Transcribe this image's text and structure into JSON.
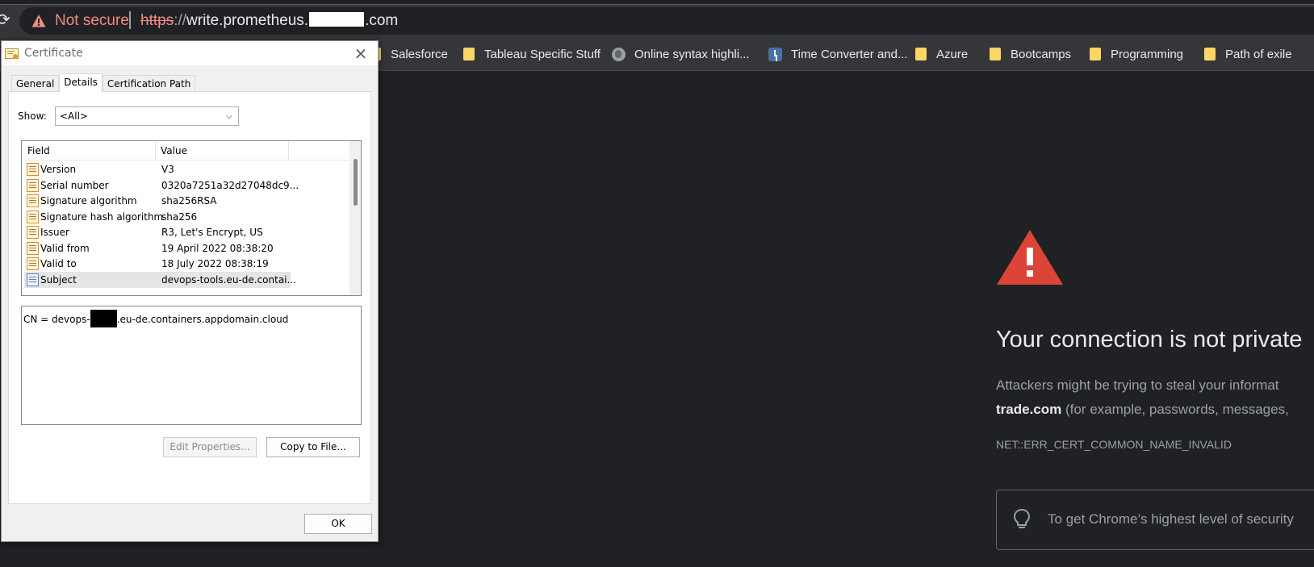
{
  "browser": {
    "security_label": "Not secure",
    "url_scheme_strike": "https",
    "url_scheme_rest": "://",
    "url_host_start": "write.prometheus.",
    "url_host_end": ".com",
    "bookmarks": [
      {
        "label": "Salesforce",
        "icon": "folder-icon"
      },
      {
        "label": "Tableau Specific Stuff",
        "icon": "folder-icon"
      },
      {
        "label": "Online syntax highli...",
        "icon": "globe-icon"
      },
      {
        "label": "Time Converter and...",
        "icon": "clock-icon"
      },
      {
        "label": "Azure",
        "icon": "folder-icon"
      },
      {
        "label": "Bootcamps",
        "icon": "folder-icon"
      },
      {
        "label": "Programming",
        "icon": "folder-icon"
      },
      {
        "label": "Path of exile",
        "icon": "folder-icon"
      }
    ]
  },
  "interstitial": {
    "title": "Your connection is not private",
    "line1": "Attackers might be trying to steal your informat",
    "line2_bold": "trade.com",
    "line2_rest": " (for example, passwords, messages,",
    "error_code": "NET::ERR_CERT_COMMON_NAME_INVALID",
    "tip": "To get Chrome’s highest level of security"
  },
  "dialog": {
    "title": "Certificate",
    "close": "×",
    "tabs": [
      "General",
      "Details",
      "Certification Path"
    ],
    "show_label": "Show:",
    "show_value": "<All>",
    "columns": {
      "field": "Field",
      "value": "Value"
    },
    "rows": [
      {
        "field": "Version",
        "value": "V3"
      },
      {
        "field": "Serial number",
        "value": "0320a7251a32d27048dc9..."
      },
      {
        "field": "Signature algorithm",
        "value": "sha256RSA"
      },
      {
        "field": "Signature hash algorithm",
        "value": "sha256"
      },
      {
        "field": "Issuer",
        "value": "R3, Let's Encrypt, US"
      },
      {
        "field": "Valid from",
        "value": "19 April 2022 08:38:20"
      },
      {
        "field": "Valid to",
        "value": "18 July 2022 08:38:19"
      },
      {
        "field": "Subject",
        "value": "devops-tools.eu-de.contai..."
      }
    ],
    "detail_prefix": "CN = devops-",
    "detail_suffix": ".eu-de.containers.appdomain.cloud",
    "edit_button": "Edit Properties...",
    "copy_button": "Copy to File...",
    "ok_button": "OK"
  },
  "colors": {
    "page_bg": "#202124",
    "warning_red": "#db4437",
    "not_secure_text": "#f28b82"
  }
}
